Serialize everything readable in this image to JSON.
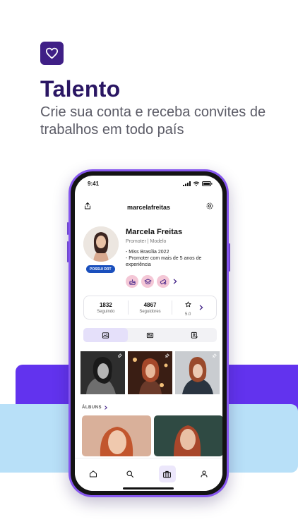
{
  "promo": {
    "logo_icon": "heart-icon",
    "headline": "Talento",
    "subline": "Crie sua conta e receba convites de trabalhos em todo país",
    "colors": {
      "brand_dark": "#3f1f86",
      "band_purple": "#6233ee",
      "band_blue": "#b8e0f8",
      "phone_frame": "#8656ef"
    }
  },
  "status_bar": {
    "time": "9:41",
    "icons": [
      "signal-icon",
      "wifi-icon",
      "battery-icon"
    ]
  },
  "profile": {
    "username": "marcelafreitas",
    "share_icon": "share-icon",
    "settings_icon": "gear-icon",
    "name": "Marcela Freitas",
    "role": "Promoter | Modelo",
    "bio": [
      "- Miss Brasília 2022",
      "- Promoter com mais de 5 anos de experiência"
    ],
    "badge": "POSSUI DRT",
    "achievements": [
      "cake-icon",
      "graduation-cap-icon",
      "diploma-icon"
    ]
  },
  "stats": {
    "following_count": "1832",
    "following_label": "Seguindo",
    "followers_count": "4867",
    "followers_label": "Seguidores",
    "rating": "5.0"
  },
  "tabs": [
    {
      "icon": "image-icon",
      "active": true
    },
    {
      "icon": "news-icon",
      "active": false
    },
    {
      "icon": "profile-edit-icon",
      "active": false
    }
  ],
  "albums": {
    "title": "ÁLBUNS"
  },
  "bottom_nav": [
    {
      "icon": "home-icon",
      "active": false
    },
    {
      "icon": "search-icon",
      "active": false
    },
    {
      "icon": "briefcase-icon",
      "active": true
    },
    {
      "icon": "user-icon",
      "active": false
    }
  ]
}
